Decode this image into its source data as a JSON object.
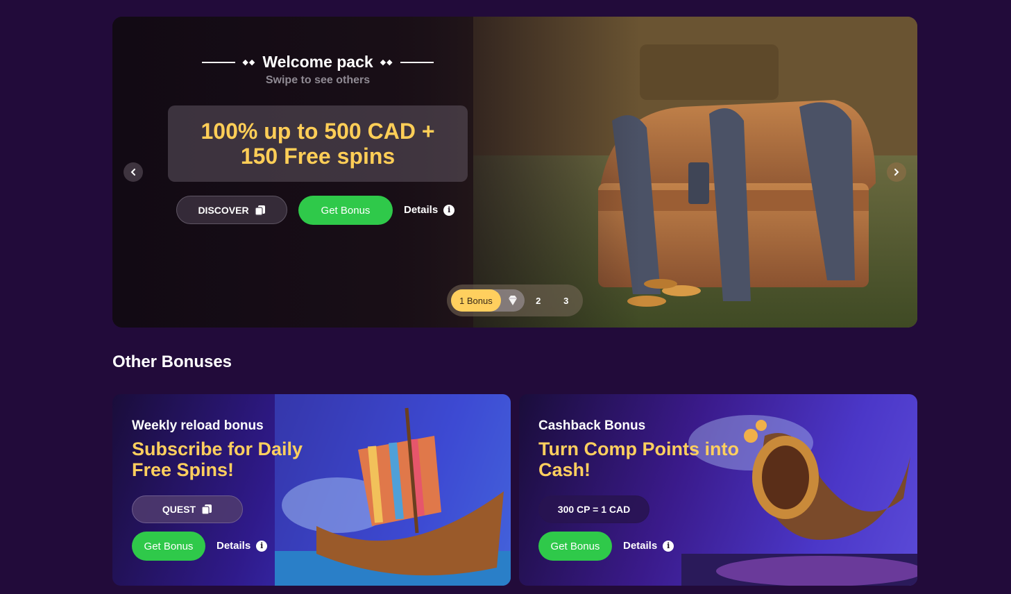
{
  "hero": {
    "title": "Welcome pack",
    "subtitle": "Swipe to see others",
    "offer_line1": "100% up to 500 CAD +",
    "offer_line2": "150 Free spins",
    "discover_label": "DISCOVER",
    "get_bonus_label": "Get Bonus",
    "details_label": "Details",
    "pager": {
      "active_label": "1 Bonus",
      "pages": [
        "2",
        "3"
      ]
    }
  },
  "section": {
    "title": "Other Bonuses"
  },
  "cards": [
    {
      "kicker": "Weekly reload bonus",
      "headline_line1": "Subscribe for Daily",
      "headline_line2": "Free Spins!",
      "tag_label": "QUEST",
      "get_bonus_label": "Get Bonus",
      "details_label": "Details"
    },
    {
      "kicker": "Cashback Bonus",
      "headline_line1": "Turn Comp Points into",
      "headline_line2": "Cash!",
      "tag_label": "300 CP = 1 CAD",
      "get_bonus_label": "Get Bonus",
      "details_label": "Details"
    }
  ],
  "colors": {
    "background": "#220b3a",
    "accent_yellow": "#ffcf5e",
    "button_green": "#2fc94a"
  }
}
